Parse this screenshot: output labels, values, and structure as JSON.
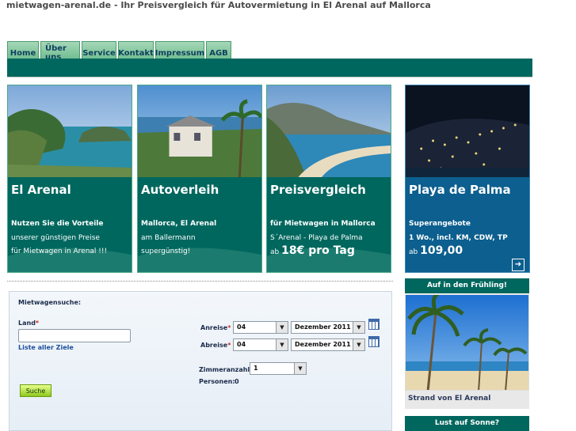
{
  "site_title": "mietwagen-arenal.de - Ihr Preisvergleich für Autovermietung in El Arenal auf Mallorca",
  "nav": [
    "Home",
    "Über uns",
    "Service",
    "Kontakt",
    "Impressum",
    "AGB"
  ],
  "cards": [
    {
      "title": "El Arenal",
      "line1": "Nutzen Sie die Vorteile",
      "line2": "unserer günstigen Preise",
      "line3": "für Mietwagen in Arenal !!!"
    },
    {
      "title": "Autoverleih",
      "line1": "Mallorca, El Arenal",
      "line2": "am Ballermann",
      "line3": "supergünstig!"
    },
    {
      "title": "Preisvergleich",
      "line1": "für Mietwagen in Mallorca",
      "line2": "S´Arenal - Playa de Palma",
      "line3_prefix": "ab",
      "line3_big": "18€ pro Tag"
    },
    {
      "title": "Playa de Palma",
      "line1": "Superangebote",
      "line2": "1 Wo., incl. KM, CDW, TP",
      "line3_prefix": "ab",
      "line3_big": "109,00",
      "arrow": "➔"
    }
  ],
  "search": {
    "heading": "Mietwagensuche:",
    "land_label": "Land",
    "required_mark": "*",
    "land_value": "",
    "all_destinations_link": "Liste aller Ziele",
    "anreise_label": "Anreise",
    "abreise_label": "Abreise",
    "anreise_day": "04",
    "anreise_month": "Dezember 2011",
    "abreise_day": "04",
    "abreise_month": "Dezember 2011",
    "rooms_label": "Zimmeranzahl",
    "rooms_value": "1",
    "persons_label": "Personen:",
    "persons_value": "0",
    "submit_label": "Suche",
    "dropdown_glyph": "▼"
  },
  "sidebar": {
    "spring_heading": "Auf in den Frühling!",
    "photo_caption": "Strand von El Arenal",
    "sun_heading": "Lust auf Sonne?"
  },
  "colors": {
    "teal": "#00675e",
    "blue": "#0c5f8e",
    "nav_green": "#5fb684"
  }
}
